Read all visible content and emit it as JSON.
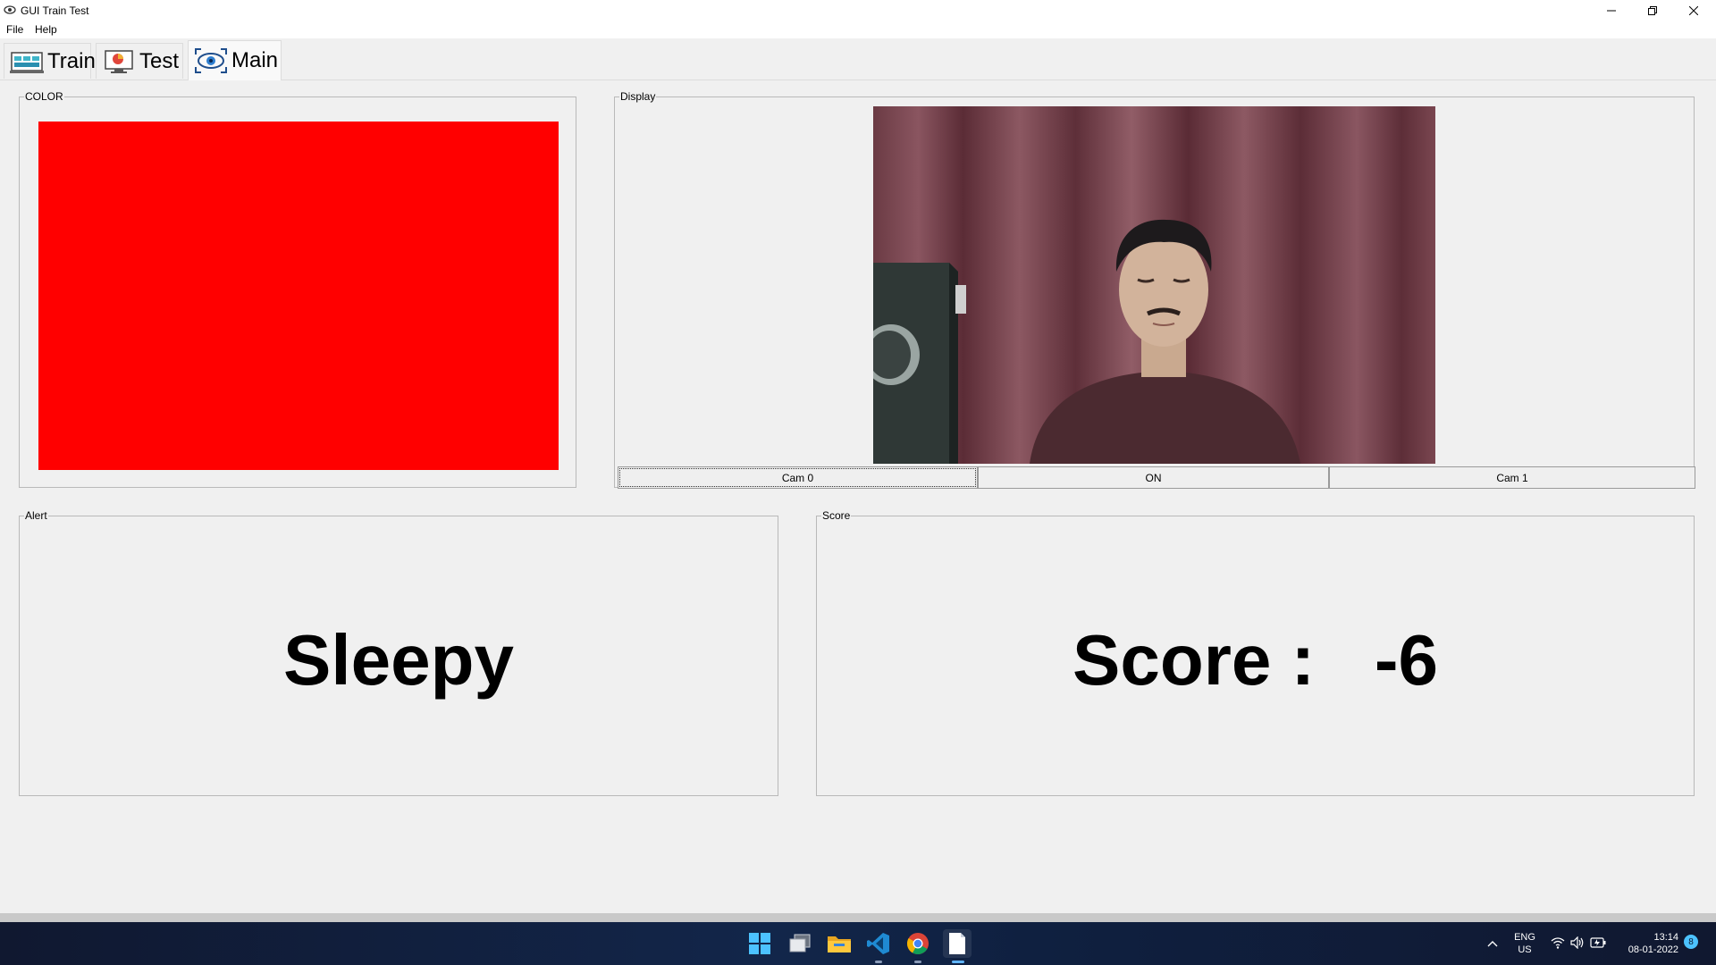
{
  "window": {
    "title": "GUI Train Test",
    "controls": [
      "minimize",
      "maximize",
      "close"
    ]
  },
  "menu": {
    "items": [
      "File",
      "Help"
    ]
  },
  "tabs": [
    {
      "label": "Train",
      "icon": "train-monitor-icon",
      "active": false
    },
    {
      "label": "Test",
      "icon": "test-chart-icon",
      "active": false
    },
    {
      "label": "Main",
      "icon": "eye-scan-icon",
      "active": true
    }
  ],
  "color_panel": {
    "title": "COLOR",
    "color": "#ff0000"
  },
  "display_panel": {
    "title": "Display",
    "image_content": "webcam-feed-person-eyes-closed",
    "buttons": [
      "Cam 0",
      "ON",
      "Cam 1"
    ]
  },
  "alert_panel": {
    "title": "Alert",
    "text": "Sleepy"
  },
  "score_panel": {
    "title": "Score",
    "text": "Score :   -6"
  },
  "taskbar": {
    "apps": [
      "start-icon",
      "task-view-icon",
      "file-explorer-icon",
      "vscode-icon",
      "chrome-icon",
      "notepad-icon"
    ],
    "tray": {
      "language_line1": "ENG",
      "language_line2": "US",
      "time": "13:14",
      "date": "08-01-2022",
      "notifications": "8"
    }
  }
}
